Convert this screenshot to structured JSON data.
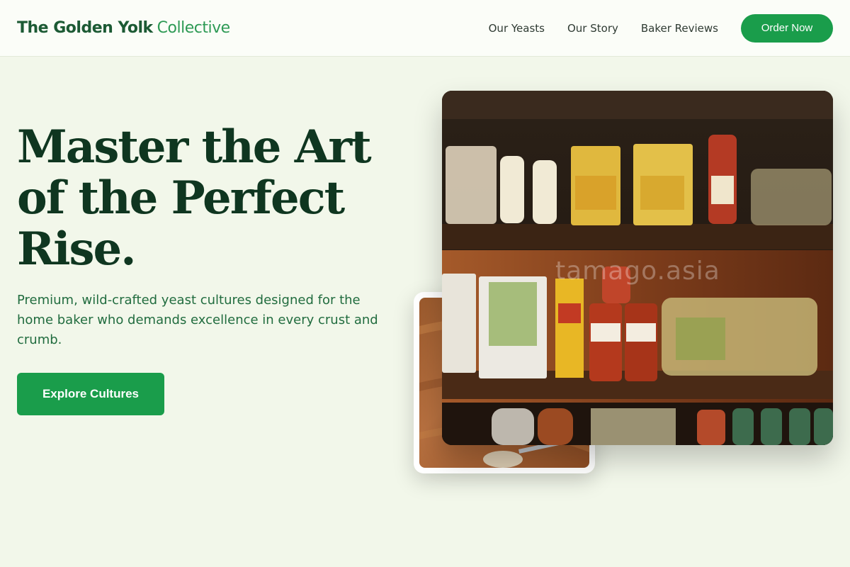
{
  "header": {
    "brand_strong": "The Golden Yolk",
    "brand_light": "Collective",
    "nav": [
      "Our Yeasts",
      "Our Story",
      "Baker Reviews"
    ],
    "order_label": "Order Now"
  },
  "hero": {
    "title": "Master the Art of the Perfect Rise.",
    "subtitle": "Premium, wild-crafted yeast cultures designed for the home baker who demands excellence in every crust and crumb.",
    "cta_label": "Explore Cultures"
  },
  "watermark": "tamago.asia",
  "colors": {
    "accent": "#1a9d4b",
    "heading": "#0f3620",
    "background": "#f2f7ea"
  }
}
